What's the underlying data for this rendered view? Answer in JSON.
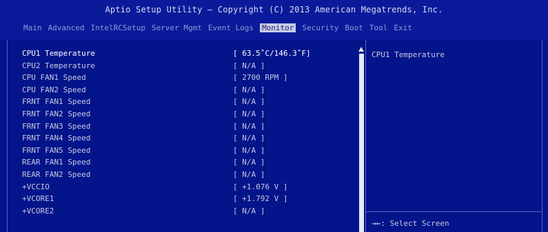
{
  "header": {
    "title": "Aptio Setup Utility – Copyright (C) 2013 American Megatrends, Inc.",
    "menu": [
      {
        "label": "Main",
        "active": false
      },
      {
        "label": "Advanced",
        "active": false
      },
      {
        "label": "IntelRCSetup",
        "active": false
      },
      {
        "label": "Server Mgmt",
        "active": false
      },
      {
        "label": "Event Logs",
        "active": false
      },
      {
        "label": "Monitor",
        "active": true
      },
      {
        "label": "Security",
        "active": false
      },
      {
        "label": "Boot",
        "active": false
      },
      {
        "label": "Tool",
        "active": false
      },
      {
        "label": "Exit",
        "active": false
      }
    ]
  },
  "main": {
    "rows": [
      {
        "label": "CPU1 Temperature",
        "value": "[ 63.5˚C/146.3˚F]",
        "selected": true
      },
      {
        "label": "CPU2 Temperature",
        "value": "[ N/A ]",
        "selected": false
      },
      {
        "label": "CPU FAN1 Speed",
        "value": "[ 2700 RPM ]",
        "selected": false
      },
      {
        "label": "CPU FAN2 Speed",
        "value": "[ N/A ]",
        "selected": false
      },
      {
        "label": "FRNT FAN1 Speed",
        "value": "[ N/A ]",
        "selected": false
      },
      {
        "label": "FRNT FAN2 Speed",
        "value": "[ N/A ]",
        "selected": false
      },
      {
        "label": "FRNT FAN3 Speed",
        "value": "[ N/A ]",
        "selected": false
      },
      {
        "label": "FRNT FAN4 Speed",
        "value": "[ N/A ]",
        "selected": false
      },
      {
        "label": "FRNT FAN5 Speed",
        "value": "[ N/A ]",
        "selected": false
      },
      {
        "label": "REAR FAN1 Speed",
        "value": "[ N/A ]",
        "selected": false
      },
      {
        "label": "REAR FAN2 Speed",
        "value": "[ N/A ]",
        "selected": false
      },
      {
        "label": "+VCCIO",
        "value": "[ +1.076 V ]",
        "selected": false
      },
      {
        "label": "+VCORE1",
        "value": "[ +1.792 V ]",
        "selected": false
      },
      {
        "label": "+VCORE2",
        "value": "[ N/A ]",
        "selected": false
      }
    ]
  },
  "help": {
    "title": "CPU1 Temperature",
    "hint_icon": "→←",
    "hint_text": ": Select Screen"
  },
  "colors": {
    "background": "#04148a",
    "header": "#0a1a9a",
    "active_tab_bg": "#c9cde6",
    "scrollbar": "#e6e9f6"
  }
}
